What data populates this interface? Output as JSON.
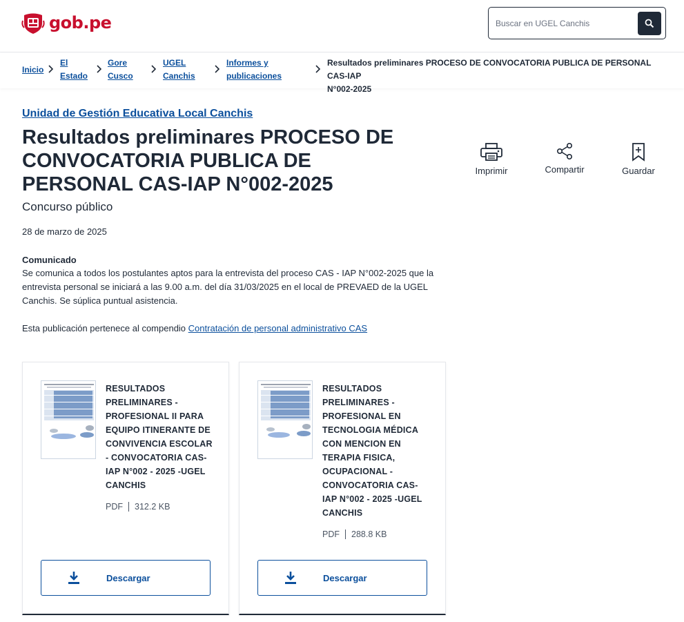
{
  "header": {
    "logo_text": "gob.pe",
    "search_placeholder": "Buscar en UGEL Canchis",
    "brand_color": "#c8102e"
  },
  "breadcrumb": [
    {
      "line1": "Inicio",
      "line2": ""
    },
    {
      "line1": "El",
      "line2": "Estado"
    },
    {
      "line1": "Gore",
      "line2": "Cusco"
    },
    {
      "line1": "UGEL",
      "line2": "Canchis"
    },
    {
      "line1": "Informes y",
      "line2": "publicaciones"
    },
    {
      "line1": "Resultados preliminares PROCESO DE CONVOCATORIA PUBLICA DE PERSONAL CAS-IAP",
      "line2": "N°002-2025"
    }
  ],
  "article": {
    "agency": "Unidad de Gestión Educativa Local Canchis",
    "title": "Resultados preliminares PROCESO DE CONVOCATORIA PUBLICA DE PERSONAL CAS-IAP N°002-2025",
    "subtitle": "Concurso público",
    "date": "28 de marzo de 2025",
    "comunicado_title": "Comunicado",
    "comunicado_body": "Se comunica a todos los postulantes aptos para la entrevista del proceso CAS - IAP N°002-2025 que la entrevista personal se iniciará a las 9.00 a.m. del día 31/03/2025 en el local de PREVAED de la UGEL Canchis. Se súplica puntual asistencia.",
    "compendio_prefix": "Esta publicación pertenece al compendio",
    "compendio_link": "Contratación de personal administrativo CAS"
  },
  "actions": {
    "print": "Imprimir",
    "share": "Compartir",
    "save": "Guardar"
  },
  "documents": [
    {
      "title": "RESULTADOS PRELIMINARES - PROFESIONAL II PARA EQUIPO ITINERANTE DE CONVIVENCIA ESCOLAR - CONVOCATORIA CAS-IAP N°002 - 2025 -UGEL CANCHIS",
      "format": "PDF",
      "size": "312.2 KB",
      "download_label": "Descargar"
    },
    {
      "title": "RESULTADOS PRELIMINARES - PROFESIONAL EN TECNOLOGIA MÉDICA CON MENCION EN TERAPIA FISICA, OCUPACIONAL - CONVOCATORIA CAS-IAP N°002 - 2025 -UGEL CANCHIS",
      "format": "PDF",
      "size": "288.8 KB",
      "download_label": "Descargar"
    }
  ],
  "colors": {
    "link": "#0b4f9c",
    "text": "#1f2937"
  }
}
